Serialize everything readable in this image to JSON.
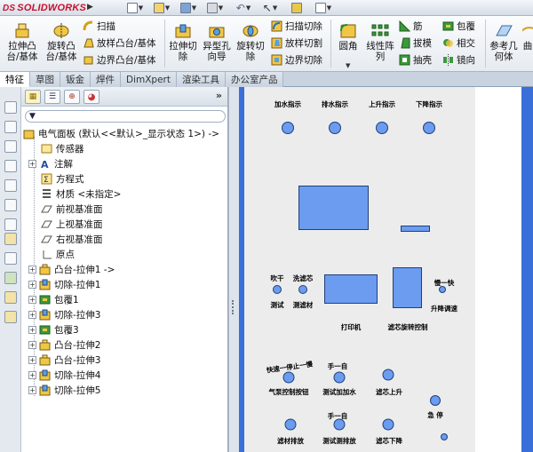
{
  "app": {
    "logo_prefix": "DS",
    "logo_name": "SOLIDWORKS"
  },
  "ribbon": {
    "boss_extrude": "拉伸凸\n台/基体",
    "boss_revolve": "旋转凸\n台/基体",
    "sweep": "扫描",
    "loft": "放样凸台/基体",
    "boundary": "边界凸台/基体",
    "cut_extrude": "拉伸切\n除",
    "hole_wizard": "异型孔\n向导",
    "cut_revolve": "旋转切\n除",
    "swept_cut": "扫描切除",
    "lofted_cut": "放样切割",
    "boundary_cut": "边界切除",
    "fillet": "圆角",
    "linear_pattern": "线性阵\n列",
    "rib": "筋",
    "draft": "拔模",
    "shell": "抽壳",
    "wrap": "包覆",
    "intersect": "相交",
    "mirror": "镜向",
    "ref_geometry": "参考几\n何体",
    "curves_partial": "曲"
  },
  "tabs": [
    "特征",
    "草图",
    "钣金",
    "焊件",
    "DimXpert",
    "渲染工具",
    "办公室产品"
  ],
  "tree": {
    "root": "电气面板  (默认<<默认>_显示状态 1>) ->",
    "items": [
      "传感器",
      "注解",
      "方程式",
      "材质 <未指定>",
      "前视基准面",
      "上视基准面",
      "右视基准面",
      "原点",
      "凸台-拉伸1 ->",
      "切除-拉伸1",
      "包覆1",
      "切除-拉伸3",
      "包覆3",
      "凸台-拉伸2",
      "凸台-拉伸3",
      "切除-拉伸4",
      "切除-拉伸5"
    ]
  },
  "panel_labels": {
    "add_water": "加水指示",
    "drain": "排水指示",
    "up": "上升指示",
    "down": "下降指示",
    "blow_dry": "吹干",
    "wash_core": "洗滤芯",
    "single_cycle": "慢一快",
    "test": "测试",
    "wash_material": "测滤材",
    "lift_fast": "升降调速",
    "printer": "打印机",
    "filter_rotate": "滤芯旋转控制",
    "arc": "快速一停止一慢",
    "hold": "手一自",
    "air_pump": "气泵控制按钮",
    "test_add_water": "测试加加水",
    "filter_up": "滤芯上升",
    "emergency": "急 停",
    "hold2": "手一自",
    "filter_drain": "滤材排放",
    "test_drain": "测试测排放",
    "filter_down": "滤芯下降"
  },
  "colors": {
    "accent": "#3a6ed8",
    "indicator": "#6b9cf0",
    "outline": "#1f3f7a"
  }
}
